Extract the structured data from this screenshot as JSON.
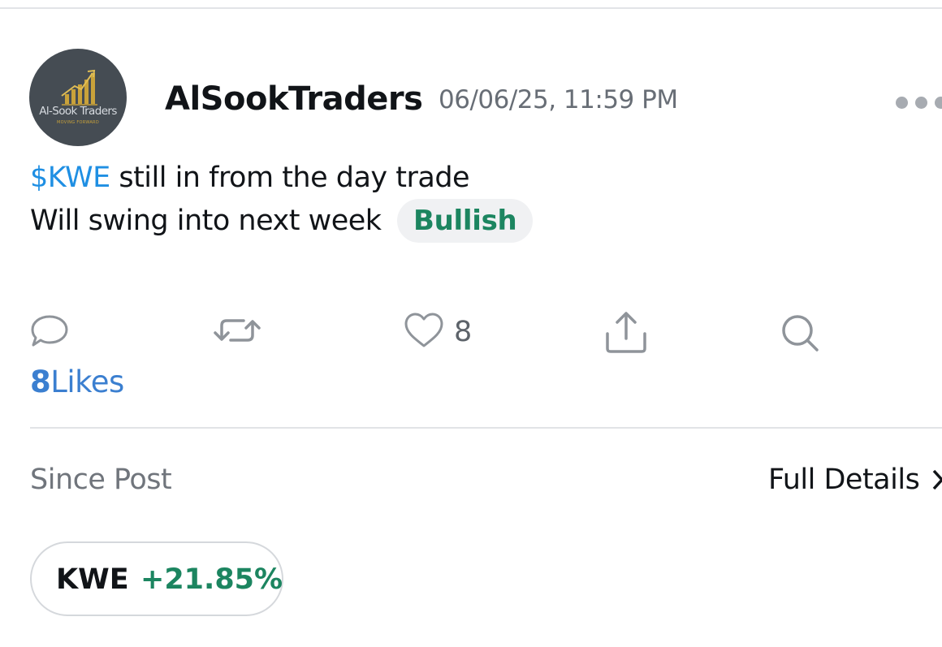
{
  "post": {
    "author": "AlSookTraders",
    "timestamp": "06/06/25, 11:59 PM",
    "avatar": {
      "brand": "Al-Sook Traders",
      "tagline": "MOVING FORWARD"
    },
    "body": {
      "ticker": "$KWE",
      "line1_rest": " still in from the day trade",
      "line2": "Will swing into next week"
    },
    "sentiment": "Bullish"
  },
  "actions": {
    "comment_icon": "comment-icon",
    "reshare_icon": "reshare-icon",
    "like_icon": "heart-icon",
    "like_count": "8",
    "share_icon": "share-icon",
    "search_icon": "search-icon"
  },
  "likes_summary": {
    "count": "8",
    "label": "Likes"
  },
  "performance": {
    "since_label": "Since Post",
    "details_label": "Full Details",
    "symbol": "KWE",
    "change": "+21.85%"
  },
  "colors": {
    "ticker": "#1f8fe3",
    "bullish": "#1c8560",
    "likes": "#3b7fd0",
    "icon": "#8f949a"
  }
}
